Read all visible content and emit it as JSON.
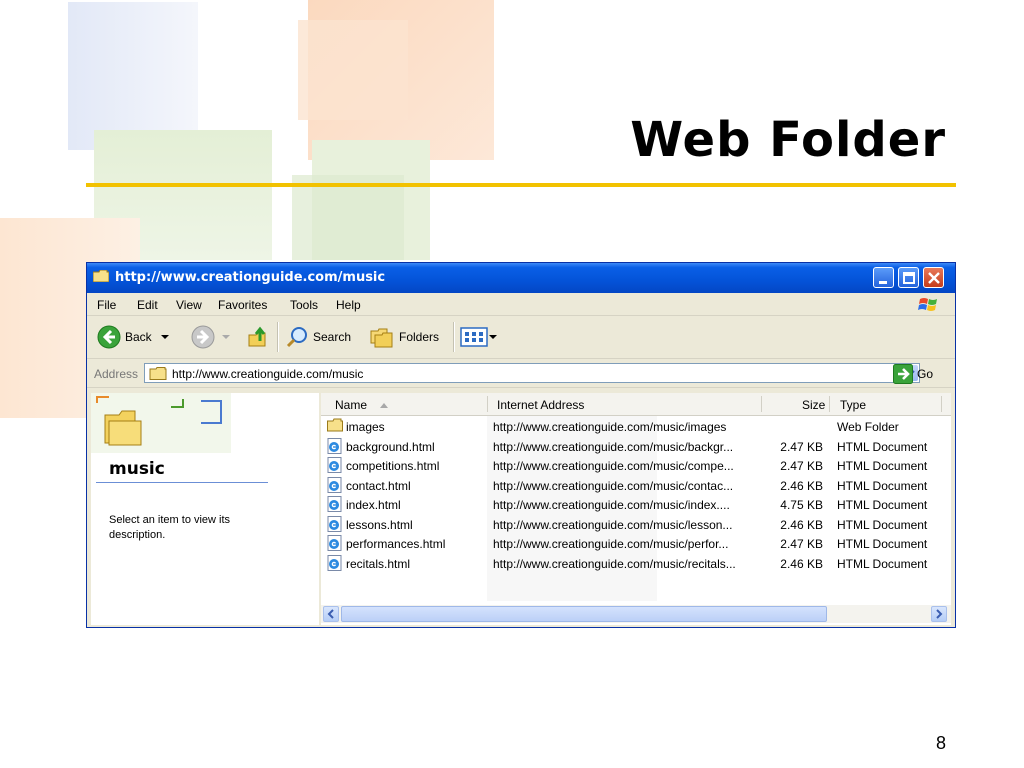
{
  "slide": {
    "title": "Web Folder",
    "page_number": "8"
  },
  "window": {
    "title": "http://www.creationguide.com/music",
    "menu": [
      "File",
      "Edit",
      "View",
      "Favorites",
      "Tools",
      "Help"
    ],
    "toolbar": {
      "back_label": "Back",
      "search_label": "Search",
      "folders_label": "Folders"
    },
    "address": {
      "label": "Address",
      "value": "http://www.creationguide.com/music",
      "go_label": "Go"
    },
    "left_pane": {
      "folder_name": "music",
      "description": "Select an item to view its description."
    },
    "columns": {
      "name": "Name",
      "internet_address": "Internet Address",
      "size": "Size",
      "type": "Type"
    },
    "files": [
      {
        "name": "images",
        "address": "http://www.creationguide.com/music/images",
        "size": "",
        "type": "Web Folder",
        "icon": "folder-icon"
      },
      {
        "name": "background.html",
        "address": "http://www.creationguide.com/music/backgr...",
        "size": "2.47 KB",
        "type": "HTML Document",
        "icon": "ie-document-icon"
      },
      {
        "name": "competitions.html",
        "address": "http://www.creationguide.com/music/compe...",
        "size": "2.47 KB",
        "type": "HTML Document",
        "icon": "ie-document-icon"
      },
      {
        "name": "contact.html",
        "address": "http://www.creationguide.com/music/contac...",
        "size": "2.46 KB",
        "type": "HTML Document",
        "icon": "ie-document-icon"
      },
      {
        "name": "index.html",
        "address": "http://www.creationguide.com/music/index....",
        "size": "4.75 KB",
        "type": "HTML Document",
        "icon": "ie-document-icon"
      },
      {
        "name": "lessons.html",
        "address": "http://www.creationguide.com/music/lesson...",
        "size": "2.46 KB",
        "type": "HTML Document",
        "icon": "ie-document-icon"
      },
      {
        "name": "performances.html",
        "address": "http://www.creationguide.com/music/perfor...",
        "size": "2.47 KB",
        "type": "HTML Document",
        "icon": "ie-document-icon"
      },
      {
        "name": "recitals.html",
        "address": "http://www.creationguide.com/music/recitals...",
        "size": "2.46 KB",
        "type": "HTML Document",
        "icon": "ie-document-icon"
      }
    ]
  },
  "colors": {
    "title_rule": "#f2c200",
    "titlebar_blue": "#0453d8",
    "window_face": "#ece9d8"
  }
}
